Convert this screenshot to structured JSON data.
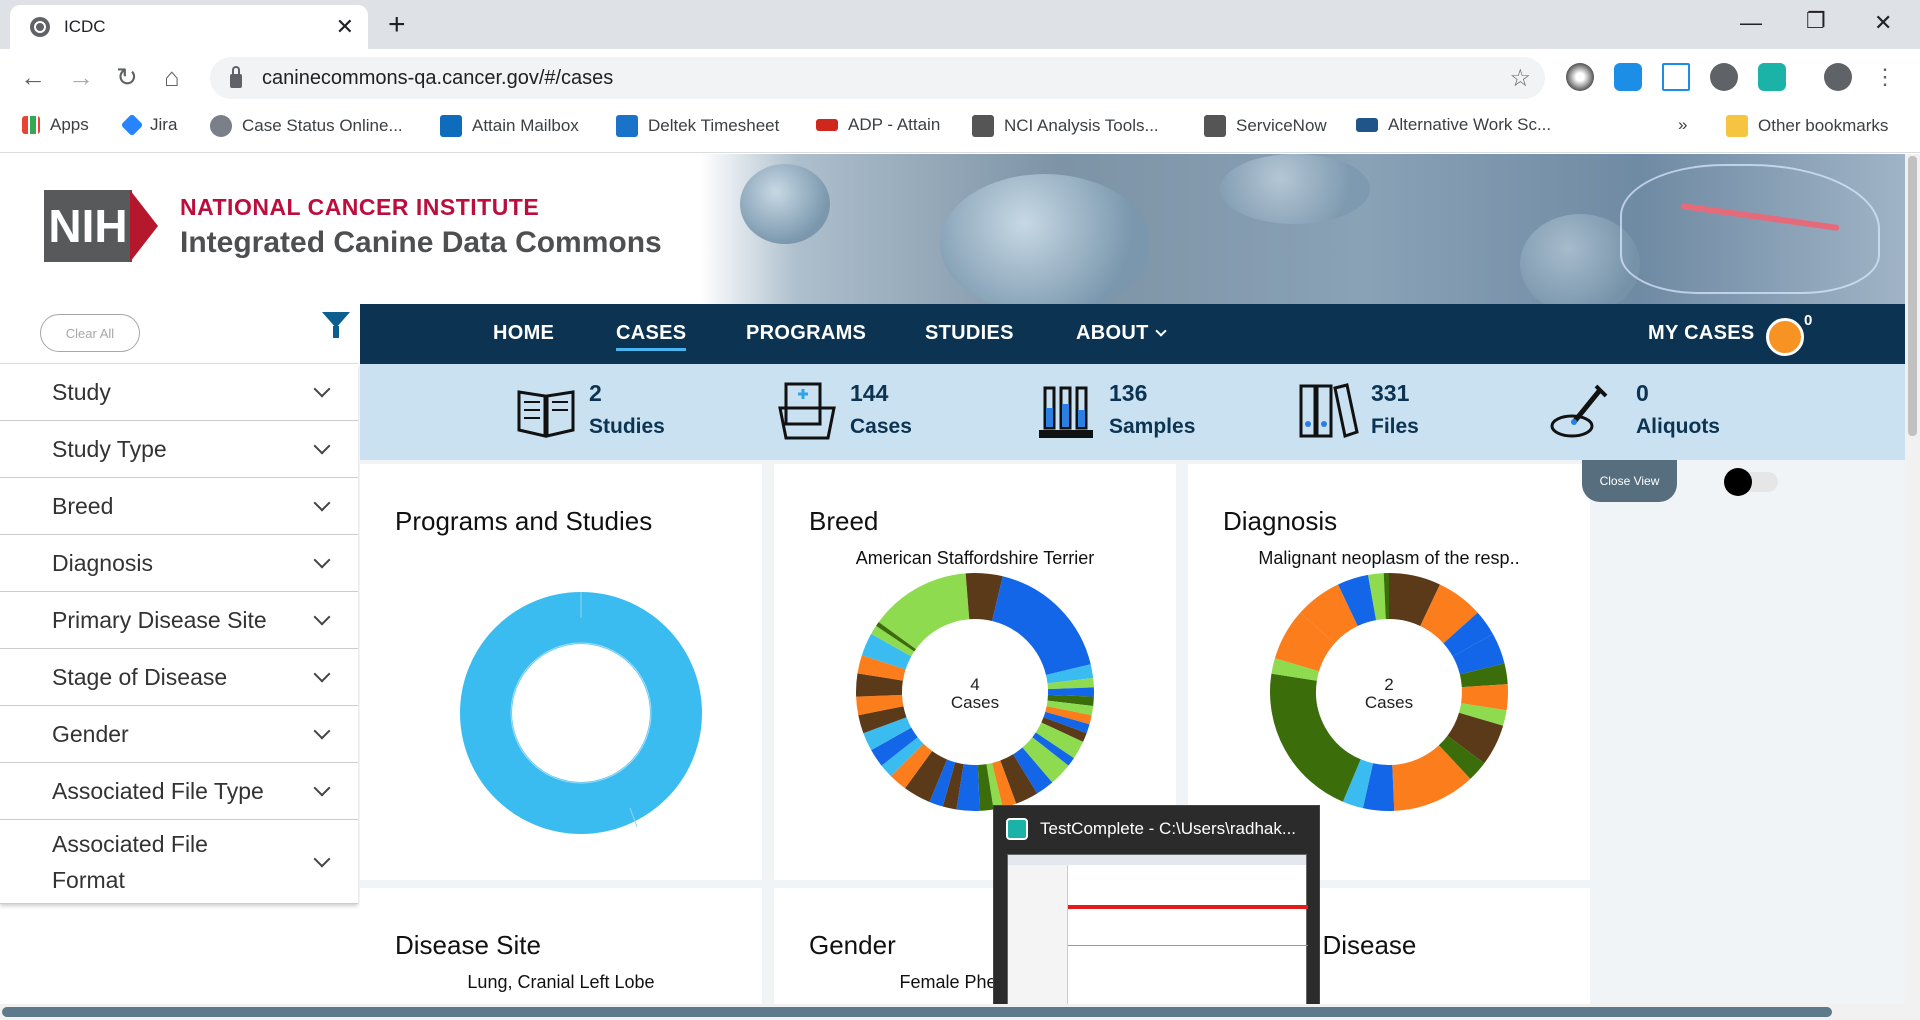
{
  "browser": {
    "tab_title": "ICDC",
    "url": "caninecommons-qa.cancer.gov/#/cases",
    "bookmarks": [
      "Apps",
      "Jira",
      "Case Status Online...",
      "Attain Mailbox",
      "Deltek Timesheet",
      "ADP - Attain",
      "NCI Analysis Tools...",
      "ServiceNow",
      "Alternative Work Sc...",
      "»",
      "Other bookmarks"
    ]
  },
  "header": {
    "nih_logo_text": "NIH",
    "institute": "NATIONAL CANCER INSTITUTE",
    "site_name": "Integrated Canine Data Commons"
  },
  "sidebar": {
    "clear_all": "Clear All",
    "facets": [
      "Study",
      "Study Type",
      "Breed",
      "Diagnosis",
      "Primary Disease Site",
      "Stage of Disease",
      "Gender",
      "Associated File Type",
      "Associated File\nFormat"
    ]
  },
  "nav": {
    "links": [
      "HOME",
      "CASES",
      "PROGRAMS",
      "STUDIES",
      "ABOUT"
    ],
    "active": "CASES",
    "my_cases": "MY CASES",
    "my_cases_count": "0"
  },
  "stats": [
    {
      "value": "2",
      "label": "Studies"
    },
    {
      "value": "144",
      "label": "Cases"
    },
    {
      "value": "136",
      "label": "Samples"
    },
    {
      "value": "331",
      "label": "Files"
    },
    {
      "value": "0",
      "label": "Aliquots"
    }
  ],
  "controls": {
    "close_view": "Close View"
  },
  "widgets": [
    {
      "title": "Programs and Studies",
      "subtitle": "",
      "center_value": "",
      "center_label": ""
    },
    {
      "title": "Breed",
      "subtitle": "American Staffordshire Terrier",
      "center_value": "4",
      "center_label": "Cases"
    },
    {
      "title": "Diagnosis",
      "subtitle": "Malignant neoplasm of the resp..",
      "center_value": "2",
      "center_label": "Cases"
    },
    {
      "title": "Disease Site",
      "subtitle": "Lung, Cranial Left Lobe"
    },
    {
      "title": "Gender",
      "subtitle": "Female Phenotype"
    },
    {
      "title": "f Disease",
      "subtitle": ""
    }
  ],
  "taskbar_preview": {
    "title": "TestComplete - C:\\Users\\radhak..."
  },
  "colors": {
    "navy": "#0c3452",
    "stats_bg": "#c9e1f0",
    "light_blue": "#3bbcf0",
    "blue": "#1466e8",
    "green": "#8fdb50",
    "orange": "#fb7d1b",
    "brown": "#5b3a1a",
    "dark_green": "#3b6d0b"
  }
}
